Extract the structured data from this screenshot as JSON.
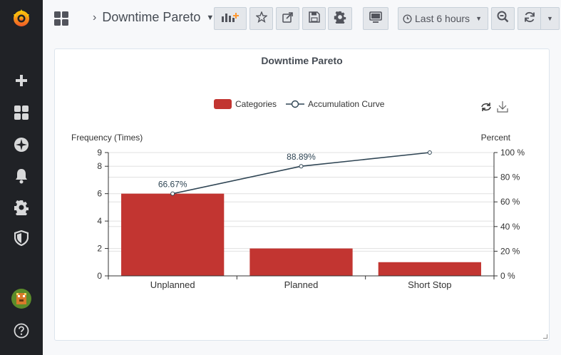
{
  "header": {
    "dashboard_title": "Downtime Pareto",
    "time_range_label": "Last 6 hours"
  },
  "icons": {
    "logo": "grafana-logo-icon",
    "sidebar": [
      "plus-icon",
      "dashboards-icon",
      "explore-icon",
      "bell-icon",
      "gear-icon",
      "shield-icon"
    ],
    "toolbar": [
      "add-panel-icon",
      "star-icon",
      "share-icon",
      "save-icon",
      "settings-icon",
      "tv-icon",
      "clock-icon",
      "zoom-out-icon",
      "refresh-icon",
      "chevron-down-icon"
    ]
  },
  "colors": {
    "bar": "#c23531",
    "line": "#2f4554",
    "sidebar_bg": "#202226"
  },
  "panel": {
    "title": "Downtime Pareto"
  },
  "chart_data": {
    "type": "bar",
    "title": "Downtime Pareto",
    "categories": [
      "Unplanned",
      "Planned",
      "Short Stop"
    ],
    "series": [
      {
        "name": "Categories",
        "type": "bar",
        "values": [
          6,
          2,
          1
        ]
      },
      {
        "name": "Accumulation Curve",
        "type": "line",
        "values": [
          66.67,
          88.89,
          100
        ],
        "labels": [
          "66.67%",
          "88.89%",
          ""
        ]
      }
    ],
    "ylabel": "Frequency (Times)",
    "ylabel_right": "Percent",
    "ylim": [
      0,
      9
    ],
    "ylim_right": [
      0,
      100
    ],
    "yticks": [
      0,
      2,
      4,
      6,
      8,
      9
    ],
    "yticks_right": [
      "0 %",
      "20 %",
      "40 %",
      "60 %",
      "80 %",
      "100 %"
    ],
    "legend_position": "top-center",
    "grid": true
  }
}
